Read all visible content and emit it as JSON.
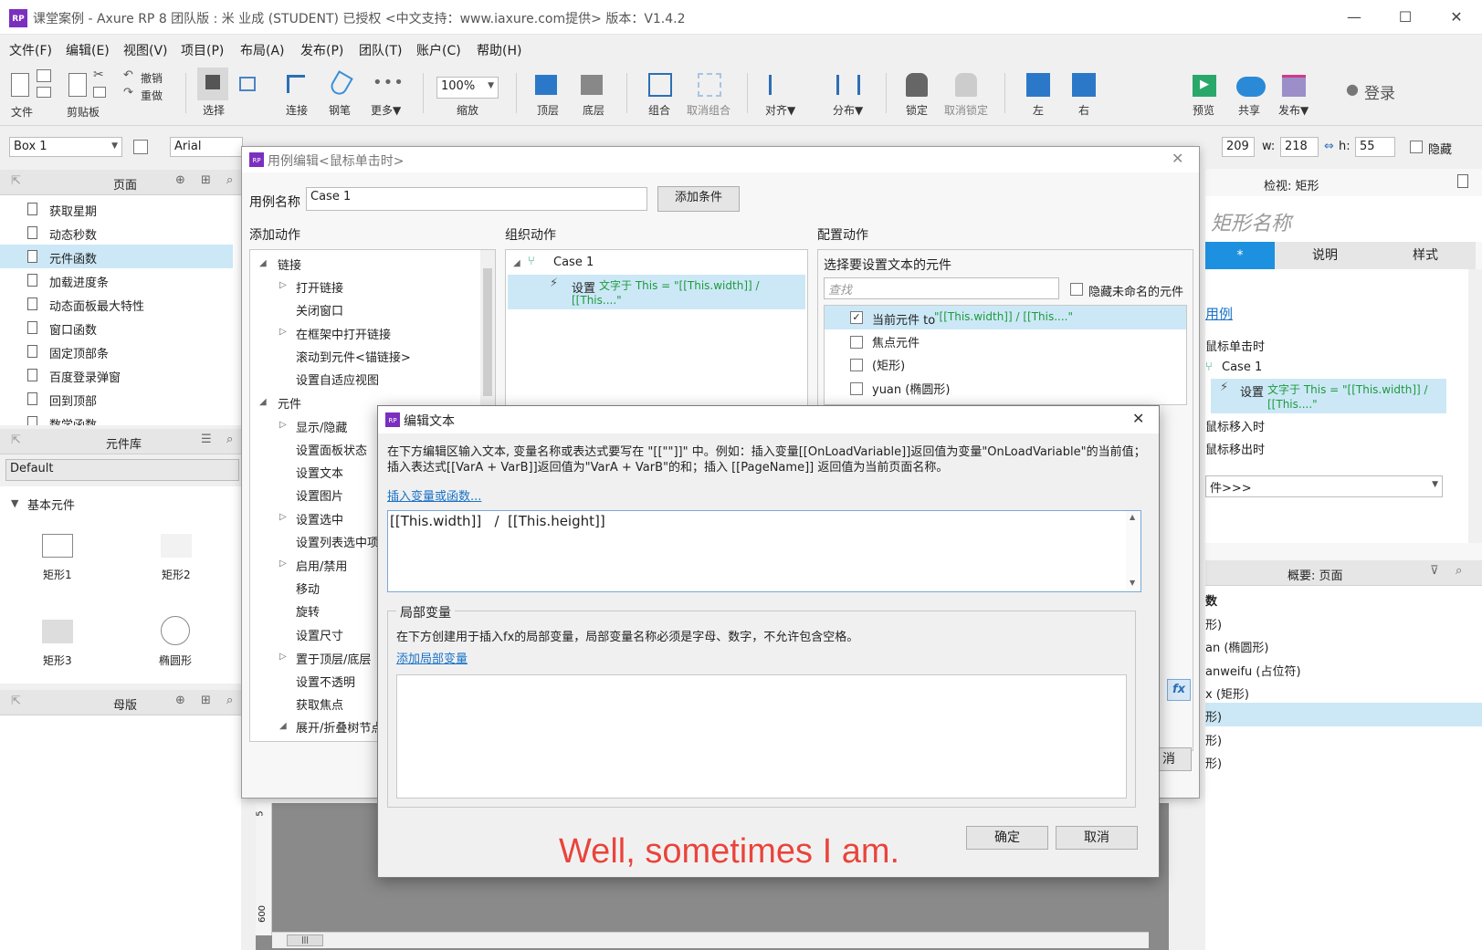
{
  "window": {
    "logo": "RP",
    "title": "课堂案例 - Axure RP 8 团队版 : 米 业成 (STUDENT) 已授权     <中文支持：www.iaxure.com提供> 版本：V1.4.2",
    "minimize": "—",
    "maximize": "☐",
    "close": "✕"
  },
  "menu": [
    "文件(F)",
    "编辑(E)",
    "视图(V)",
    "项目(P)",
    "布局(A)",
    "发布(P)",
    "团队(T)",
    "账户(C)",
    "帮助(H)"
  ],
  "toolbar": {
    "file": "文件",
    "clipboard": "剪贴板",
    "undo": "撤销",
    "redo": "重做",
    "select": "选择",
    "connect": "连接",
    "pen": "钢笔",
    "more": "更多▼",
    "zoom_value": "100%",
    "zoom": "缩放",
    "top_layer": "顶层",
    "bottom_layer": "底层",
    "group": "组合",
    "ungroup": "取消组合",
    "align": "对齐▼",
    "distribute": "分布▼",
    "lock": "锁定",
    "unlock": "取消锁定",
    "left": "左",
    "right": "右",
    "preview": "预览",
    "share": "共享",
    "publish": "发布▼",
    "login": "登录"
  },
  "propbar": {
    "widget_name": "Box 1",
    "font": "Arial",
    "y_value": "209",
    "w_label": "w:",
    "w_value": "218",
    "h_label": "h:",
    "h_value": "55",
    "hide_label": "隐藏"
  },
  "pages_panel": {
    "title": "页面",
    "items": [
      "获取星期",
      "动态秒数",
      "元件函数",
      "加载进度条",
      "动态面板最大特性",
      "窗口函数",
      "固定顶部条",
      "百度登录弹窗",
      "回到顶部",
      "数学函数"
    ],
    "selected_index": 2
  },
  "widgets_panel": {
    "title": "元件库",
    "library": "Default",
    "category": "基本元件",
    "items": [
      "矩形1",
      "矩形2",
      "矩形3",
      "椭圆形"
    ]
  },
  "masters_panel": {
    "title": "母版"
  },
  "case_dialog": {
    "logo": "RP",
    "title": "用例编辑<鼠标单击时>",
    "case_name_label": "用例名称",
    "case_name_value": "Case 1",
    "add_condition": "添加条件",
    "add_action_title": "添加动作",
    "organize_title": "组织动作",
    "config_title": "配置动作",
    "actions": [
      {
        "label": "链接",
        "level": 0,
        "expanded": true
      },
      {
        "label": "打开链接",
        "level": 1,
        "has_children": true
      },
      {
        "label": "关闭窗口",
        "level": 1
      },
      {
        "label": "在框架中打开链接",
        "level": 1,
        "has_children": true
      },
      {
        "label": "滚动到元件<锚链接>",
        "level": 1
      },
      {
        "label": "设置自适应视图",
        "level": 1
      },
      {
        "label": "元件",
        "level": 0,
        "expanded": true
      },
      {
        "label": "显示/隐藏",
        "level": 1,
        "has_children": true
      },
      {
        "label": "设置面板状态",
        "level": 1
      },
      {
        "label": "设置文本",
        "level": 1
      },
      {
        "label": "设置图片",
        "level": 1
      },
      {
        "label": "设置选中",
        "level": 1,
        "has_children": true
      },
      {
        "label": "设置列表选中项",
        "level": 1
      },
      {
        "label": "启用/禁用",
        "level": 1,
        "has_children": true
      },
      {
        "label": "移动",
        "level": 1
      },
      {
        "label": "旋转",
        "level": 1
      },
      {
        "label": "设置尺寸",
        "level": 1
      },
      {
        "label": "置于顶层/底层",
        "level": 1,
        "has_children": true
      },
      {
        "label": "设置不透明",
        "level": 1
      },
      {
        "label": "获取焦点",
        "level": 1
      },
      {
        "label": "展开/折叠树节点",
        "level": 1,
        "expanded": true
      }
    ],
    "organize": {
      "case": "Case 1",
      "action_prefix": "设置",
      "action_detail": "文字于 This = \"[[This.width]]   /   [[This....\""
    },
    "config": {
      "choose_label": "选择要设置文本的元件",
      "search_placeholder": "查找",
      "hide_unnamed": "隐藏未命名的元件",
      "targets": [
        {
          "prefix": "当前元件 to ",
          "detail": "\"[[This.width]]   /   [[This....\"",
          "checked": true
        },
        {
          "prefix": "焦点元件",
          "detail": "",
          "checked": false
        },
        {
          "prefix": "(矩形)",
          "detail": "",
          "checked": false
        },
        {
          "prefix": "yuan (椭圆形)",
          "detail": "",
          "checked": false
        }
      ],
      "fx": "fx",
      "cancel_fragment": "消"
    }
  },
  "edit_dialog": {
    "logo": "RP",
    "title": "编辑文本",
    "close": "✕",
    "description": "在下方编辑区输入文本, 变量名称或表达式要写在 \"[[\"\"]]\" 中。例如：插入变量[[OnLoadVariable]]返回值为变量\"OnLoadVariable\"的当前值；插入表达式[[VarA + VarB]]返回值为\"VarA + VarB\"的和；插入 [[PageName]] 返回值为当前页面名称。",
    "insert_link": "插入变量或函数...",
    "text_value": "[[This.width]]   /  [[This.height]]",
    "local_vars_title": "局部变量",
    "local_vars_desc": "在下方创建用于插入fx的局部变量，局部变量名称必须是字母、数字，不允许包含空格。",
    "add_local_var": "添加局部变量",
    "ok": "确定",
    "cancel": "取消"
  },
  "inspector": {
    "title": "检视: 矩形",
    "shape_name_placeholder": "矩形名称",
    "tab_star": "*",
    "tab_notes": "说明",
    "tab_style": "样式",
    "interactions": {
      "cases_link": "用例",
      "on_click": "鼠标单击时",
      "case": "Case 1",
      "action_prefix": "设置",
      "action_detail": "文字于 This = \"[[This.width]]   /   [[This....\"",
      "on_mouse_enter": "鼠标移入时",
      "on_mouse_leave": "鼠标移出时",
      "more_events": "件>>>"
    },
    "outline": {
      "title": "概要: 页面",
      "items": [
        "数",
        "形)",
        "an (椭圆形)",
        "anweifu (占位符)",
        "x (矩形)",
        "形)",
        "形)",
        "形)"
      ],
      "selected_index": 5
    }
  },
  "canvas": {
    "ruler_marks": [
      "5",
      "600"
    ],
    "scroll_thumb": "|||"
  },
  "caption": "Well, sometimes I am.",
  "colors": {
    "brand": "#7b2fbf",
    "selection": "#cce8f7",
    "link": "#1a73c8",
    "action_green": "#1f9a3c",
    "tab_active": "#1e90e0",
    "caption": "#e8453c"
  }
}
